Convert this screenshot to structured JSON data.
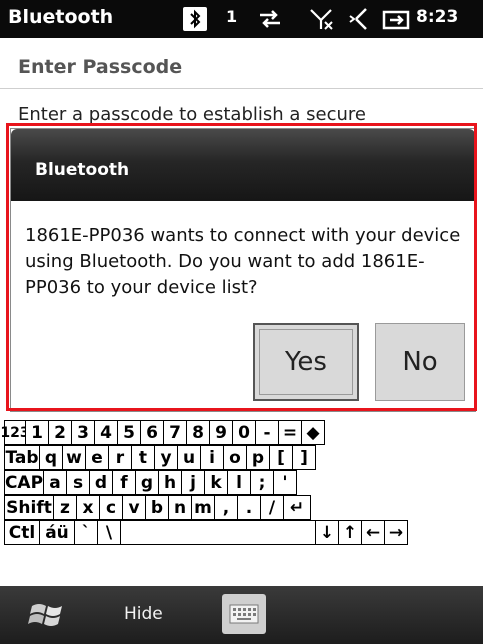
{
  "status_bar": {
    "title": "Bluetooth",
    "signal_count": "1",
    "time": "8:23",
    "icons": [
      "bluetooth-icon",
      "signal-count",
      "data-transfer-icon",
      "no-signal-icon",
      "volume-muted-icon",
      "battery-charging-icon"
    ]
  },
  "page": {
    "heading": "Enter Passcode",
    "text": "Enter a passcode to establish a secure"
  },
  "dialog": {
    "title": "Bluetooth",
    "message": "1861E-PP036 wants to connect with your device using Bluetooth. Do you want to add 1861E-PP036 to your device list?",
    "yes_label": "Yes",
    "no_label": "No"
  },
  "keyboard": {
    "rows": [
      [
        "123",
        "1",
        "2",
        "3",
        "4",
        "5",
        "6",
        "7",
        "8",
        "9",
        "0",
        "-",
        "=",
        "◆"
      ],
      [
        "Tab",
        "q",
        "w",
        "e",
        "r",
        "t",
        "y",
        "u",
        "i",
        "o",
        "p",
        "[",
        "]"
      ],
      [
        "CAP",
        "a",
        "s",
        "d",
        "f",
        "g",
        "h",
        "j",
        "k",
        "l",
        ";",
        "'"
      ],
      [
        "Shift",
        "z",
        "x",
        "c",
        "v",
        "b",
        "n",
        "m",
        ",",
        ".",
        "/",
        "↵"
      ],
      [
        "Ctl",
        "áü",
        "`",
        "\\",
        "",
        "↓",
        "↑",
        "←",
        "→"
      ]
    ]
  },
  "menu_bar": {
    "left_label": "Hide"
  },
  "colors": {
    "highlight": "#e8141c",
    "dialog_header": "#1c1c1c",
    "status_bar": "#0a0a0a"
  }
}
